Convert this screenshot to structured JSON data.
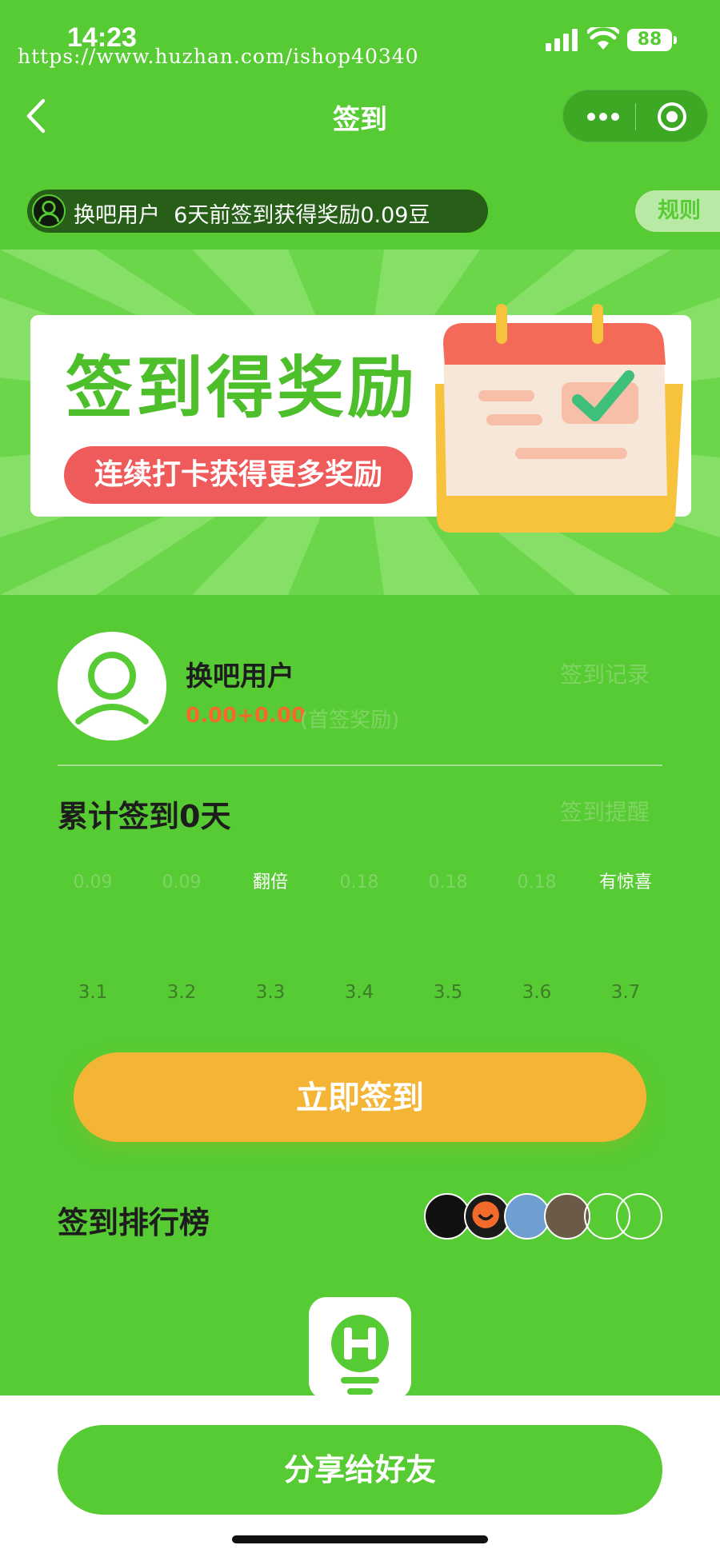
{
  "status_bar": {
    "time": "14:23",
    "battery": "88",
    "watermark": "https://www.huzhan.com/ishop40340"
  },
  "nav": {
    "title": "签到"
  },
  "marquee": {
    "user": "换吧用户",
    "message": "6天前签到获得奖励0.09豆"
  },
  "rules_label": "规则",
  "banner": {
    "title": "签到得奖励",
    "subtitle": "连续打卡获得更多奖励"
  },
  "user": {
    "name": "换吧用户",
    "amount": "0.00+0.00",
    "bonus_label": "(首签奖励)",
    "records_link": "签到记录"
  },
  "summary": {
    "total_text": "累计签到0天",
    "remind_link": "签到提醒"
  },
  "days": [
    {
      "reward": "0.09",
      "date": "3.1"
    },
    {
      "reward": "0.09",
      "date": "3.2"
    },
    {
      "reward": "翻倍",
      "date": "3.3"
    },
    {
      "reward": "0.18",
      "date": "3.4"
    },
    {
      "reward": "0.18",
      "date": "3.5"
    },
    {
      "reward": "0.18",
      "date": "3.6"
    },
    {
      "reward": "有惊喜",
      "date": "3.7"
    }
  ],
  "signin_button": "立即签到",
  "ranking": {
    "title": "签到排行榜"
  },
  "share_button": "分享给好友",
  "colors": {
    "brand_green": "#57cb33",
    "signin_orange": "#f4b536",
    "amount_orange": "#f56a2a",
    "banner_red": "#ef5b5b"
  }
}
